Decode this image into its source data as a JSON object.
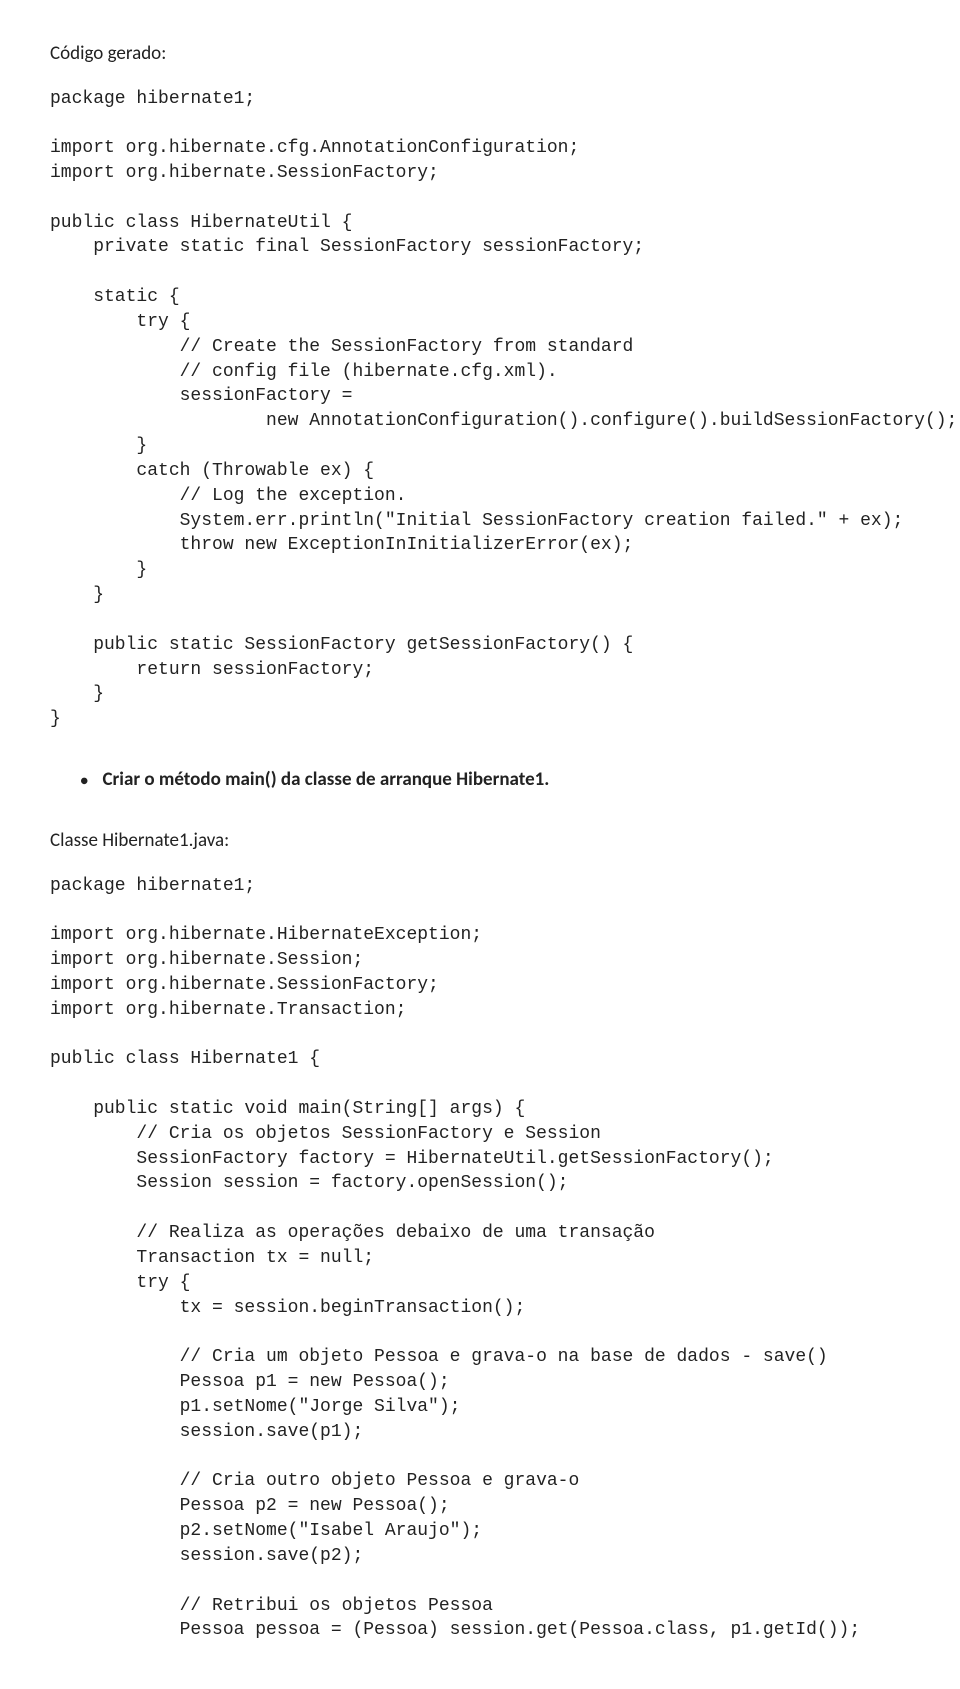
{
  "heading1": "Código gerado:",
  "code1": "package hibernate1;\n\nimport org.hibernate.cfg.AnnotationConfiguration;\nimport org.hibernate.SessionFactory;\n\npublic class HibernateUtil {\n    private static final SessionFactory sessionFactory;\n\n    static {\n        try {\n            // Create the SessionFactory from standard\n            // config file (hibernate.cfg.xml).\n            sessionFactory =\n                    new AnnotationConfiguration().configure().buildSessionFactory();\n        }\n        catch (Throwable ex) {\n            // Log the exception.\n            System.err.println(\"Initial SessionFactory creation failed.\" + ex);\n            throw new ExceptionInInitializerError(ex);\n        }\n    }\n\n    public static SessionFactory getSessionFactory() {\n        return sessionFactory;\n    }\n}",
  "bullet1": "Criar o método main() da classe de arranque Hibernate1.",
  "heading2": "Classe Hibernate1.java:",
  "code2": "package hibernate1;\n\nimport org.hibernate.HibernateException;\nimport org.hibernate.Session;\nimport org.hibernate.SessionFactory;\nimport org.hibernate.Transaction;\n\npublic class Hibernate1 {\n\n    public static void main(String[] args) {\n        // Cria os objetos SessionFactory e Session\n        SessionFactory factory = HibernateUtil.getSessionFactory();\n        Session session = factory.openSession();\n\n        // Realiza as operações debaixo de uma transação\n        Transaction tx = null;\n        try {\n            tx = session.beginTransaction();\n\n            // Cria um objeto Pessoa e grava-o na base de dados - save()\n            Pessoa p1 = new Pessoa();\n            p1.setNome(\"Jorge Silva\");\n            session.save(p1);\n\n            // Cria outro objeto Pessoa e grava-o\n            Pessoa p2 = new Pessoa();\n            p2.setNome(\"Isabel Araujo\");\n            session.save(p2);\n\n            // Retribui os objetos Pessoa\n            Pessoa pessoa = (Pessoa) session.get(Pessoa.class, p1.getId());"
}
